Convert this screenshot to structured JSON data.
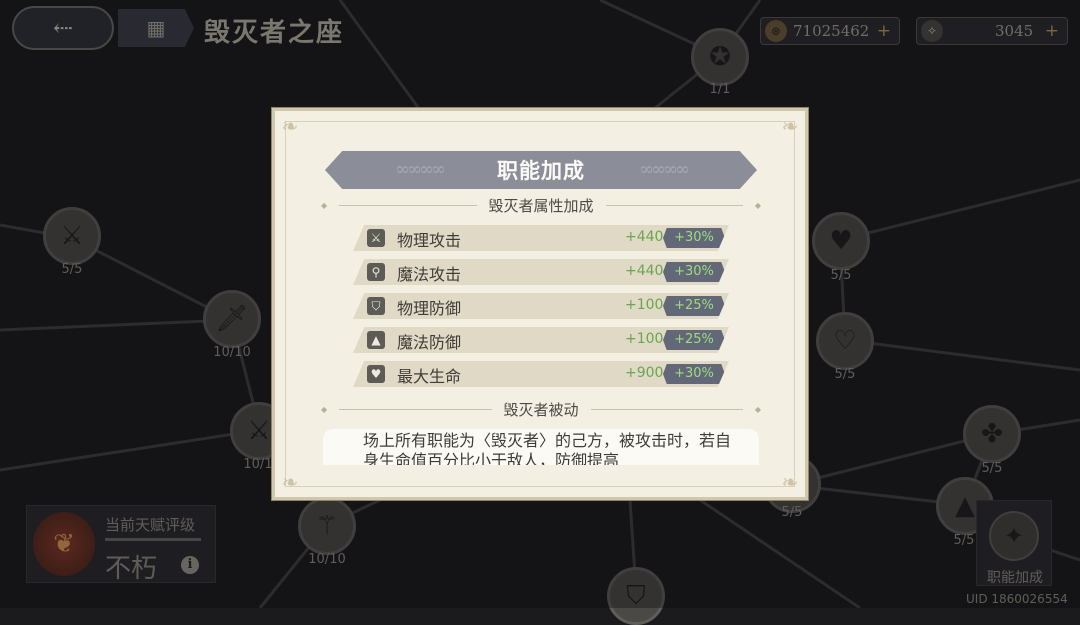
{
  "header": {
    "back_icon": "back-arrow-icon",
    "tab_icon": "grid-icon",
    "title": "毁灭者之座"
  },
  "currencies": [
    {
      "icon": "gold-coin-icon",
      "value": "71025462",
      "plus": "+"
    },
    {
      "icon": "crystal-icon",
      "value": "3045",
      "plus": "+"
    }
  ],
  "nodes": [
    {
      "count": "1/1"
    },
    {
      "count": "5/5"
    },
    {
      "count": "10/10"
    },
    {
      "count": "10/1"
    },
    {
      "count": "10/10"
    },
    {
      "count": "5/5"
    },
    {
      "count": "5/5"
    },
    {
      "count": "5/5"
    },
    {
      "count": "5/5"
    },
    {
      "count": "5/5"
    }
  ],
  "rating": {
    "label": "当前天赋评级",
    "value": "不朽",
    "info": "i"
  },
  "class_bonus_button": {
    "label": "职能加成"
  },
  "uid": "UID 1860026554",
  "modal": {
    "title": "职能加成",
    "attr_section": "毁灭者属性加成",
    "stats": [
      {
        "icon": "sword-icon",
        "name": "物理攻击",
        "add": "+440",
        "pct": "+30%"
      },
      {
        "icon": "wand-icon",
        "name": "魔法攻击",
        "add": "+440",
        "pct": "+30%"
      },
      {
        "icon": "shield-icon",
        "name": "物理防御",
        "add": "+100",
        "pct": "+25%"
      },
      {
        "icon": "hat-icon",
        "name": "魔法防御",
        "add": "+100",
        "pct": "+25%"
      },
      {
        "icon": "heart-icon",
        "name": "最大生命",
        "add": "+900",
        "pct": "+30%"
      }
    ],
    "passive_section": "毁灭者被动",
    "passive_text": "场上所有职能为〈毁灭者〉的己方，被攻击时，若自身生命值百分比小于敌人，防御提高"
  },
  "colors": {
    "background": "#1b1b1e",
    "modal_bg": "#f3efe2",
    "ribbon": "#8b8d99",
    "pct_badge": "#636878",
    "green": "#6aa64d"
  }
}
